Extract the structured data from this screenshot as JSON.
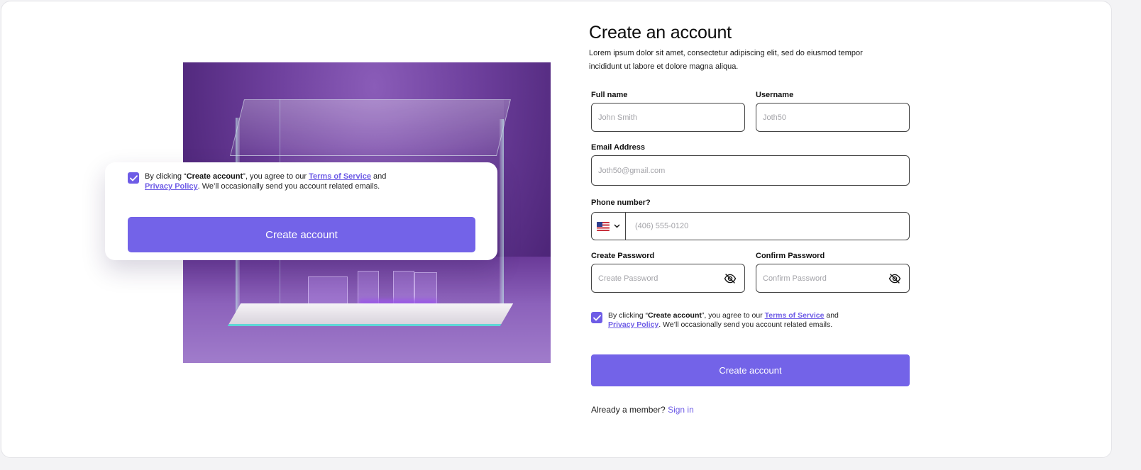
{
  "form": {
    "title": "Create an account",
    "subtitle": "Lorem ipsum dolor sit amet, consectetur adipiscing elit, sed do eiusmod tempor incididunt ut labore et dolore magna aliqua.",
    "full_name": {
      "label": "Full name",
      "placeholder": "John Smith"
    },
    "username": {
      "label": "Username",
      "placeholder": "Joth50"
    },
    "email": {
      "label": "Email Address",
      "placeholder": "Joth50@gmail.com"
    },
    "phone": {
      "label": "Phone number?",
      "placeholder": "(406) 555-0120",
      "country_icon": "us-flag-icon"
    },
    "create_password": {
      "label": "Create Password",
      "placeholder": "Create Password"
    },
    "confirm_password": {
      "label": "Confirm Password",
      "placeholder": "Confirm Password"
    },
    "consent": {
      "prefix": "By clicking “",
      "bold": "Create account",
      "middle": "”, you agree to our ",
      "terms_link": "Terms of Service",
      "and": " and",
      "privacy_link": "Privacy Policy",
      "suffix": ". We’ll occasionally send you account related emails."
    },
    "submit_label": "Create account",
    "signin_prompt": "Already a member?",
    "signin_link": "Sign in"
  },
  "floating_card": {
    "consent": {
      "prefix": "By clicking “",
      "bold": "Create account",
      "middle": "”, you agree to our ",
      "terms_link": "Terms of Service",
      "and": " and",
      "privacy_link": "Privacy Policy",
      "suffix": ". We’ll occasionally send you account related emails."
    },
    "submit_label": "Create account"
  },
  "colors": {
    "accent": "#7363e8",
    "link": "#6e5ce6",
    "hero_purple": "#5a2f8a"
  }
}
